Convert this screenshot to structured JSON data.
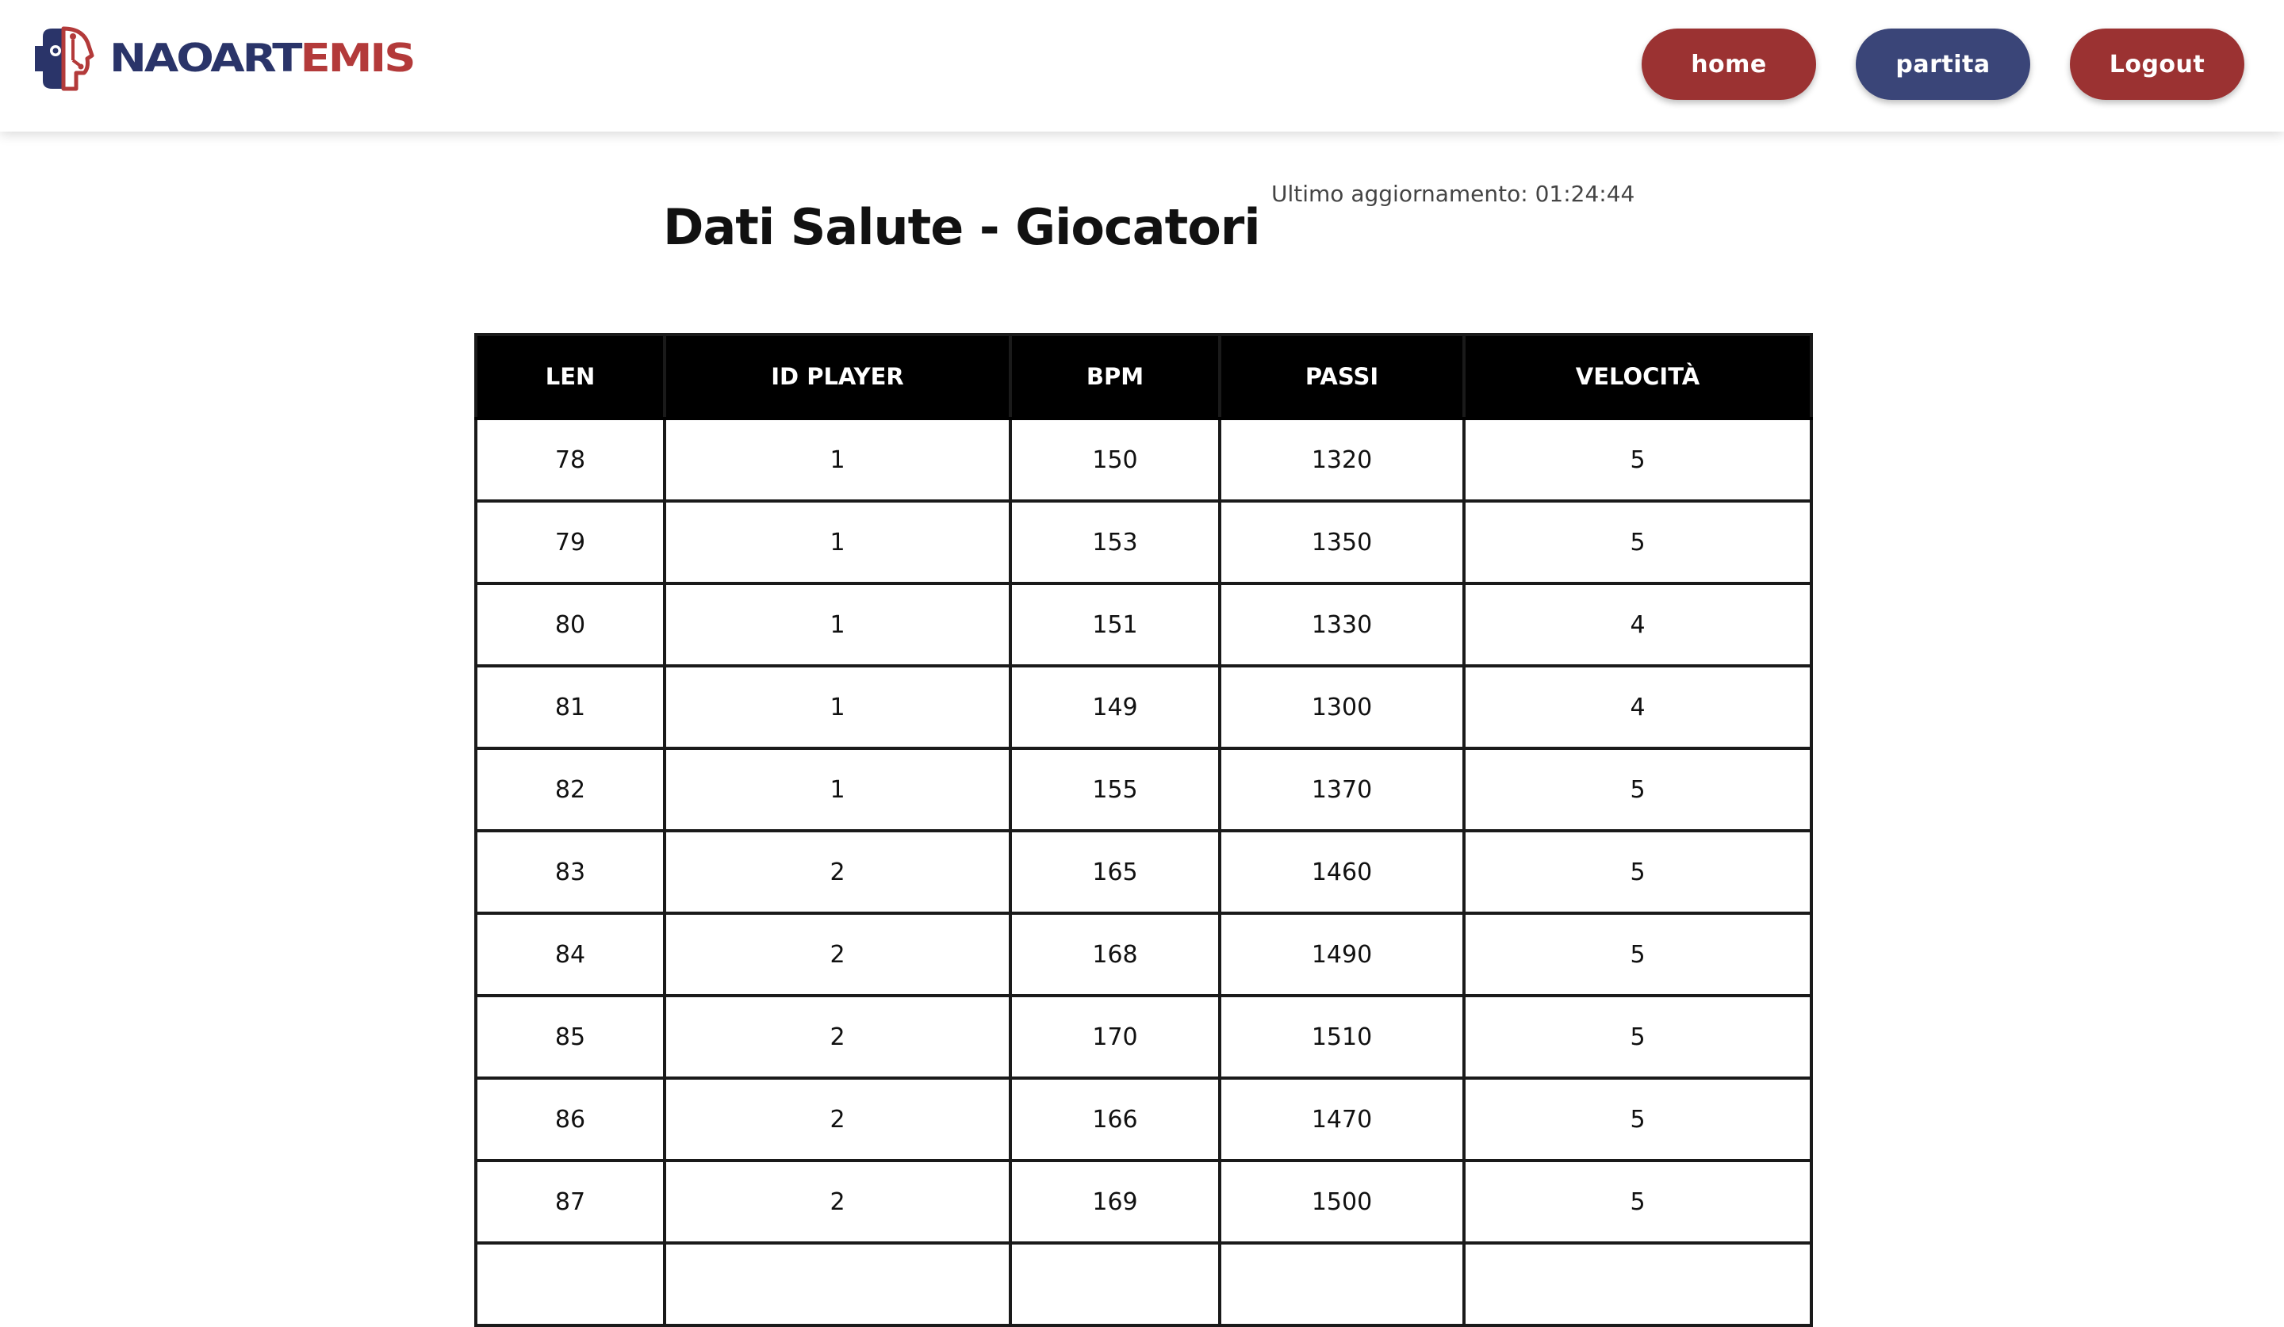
{
  "brand": {
    "logo_text_a": "NAOART",
    "logo_text_b": "EMIS",
    "colors": {
      "navy": "#2a3469",
      "red": "#b33a3a"
    }
  },
  "nav": {
    "home_label": "home",
    "partita_label": "partita",
    "logout_label": "Logout",
    "home_color": "#9b3232",
    "partita_color": "#3a4578",
    "logout_color": "#9b3232"
  },
  "page": {
    "title": "Dati Salute - Giocatori",
    "last_update": "Ultimo aggiornamento: 01:24:44"
  },
  "table": {
    "columns": [
      "LEN",
      "ID PLAYER",
      "BPM",
      "PASSI",
      "VELOCITÀ"
    ],
    "rows": [
      [
        "78",
        "1",
        "150",
        "1320",
        "5"
      ],
      [
        "79",
        "1",
        "153",
        "1350",
        "5"
      ],
      [
        "80",
        "1",
        "151",
        "1330",
        "4"
      ],
      [
        "81",
        "1",
        "149",
        "1300",
        "4"
      ],
      [
        "82",
        "1",
        "155",
        "1370",
        "5"
      ],
      [
        "83",
        "2",
        "165",
        "1460",
        "5"
      ],
      [
        "84",
        "2",
        "168",
        "1490",
        "5"
      ],
      [
        "85",
        "2",
        "170",
        "1510",
        "5"
      ],
      [
        "86",
        "2",
        "166",
        "1470",
        "5"
      ],
      [
        "87",
        "2",
        "169",
        "1500",
        "5"
      ],
      [
        "",
        "",
        "",
        "",
        ""
      ]
    ]
  }
}
